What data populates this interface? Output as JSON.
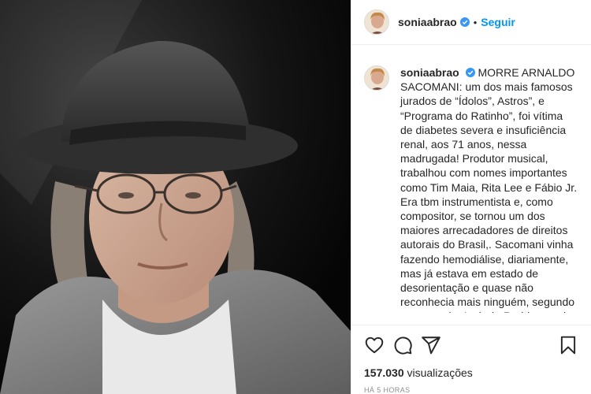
{
  "post": {
    "photo_alt": "photo-portrait-man-hat",
    "header": {
      "username": "soniaabrao",
      "separator": "•",
      "follow_label": "Seguir",
      "verified_icon": "verified-badge-icon"
    },
    "caption": {
      "username": "soniaabrao",
      "text": "MORRE ARNALDO SACOMANI: um dos mais famosos jurados de “Ídolos”, Astros”, e “Programa do Ratinho”, foi vítima de diabetes severa e insuficiência renal, aos 71 anos, nessa madrugada! Produtor musical, trabalhou com nomes importantes como Tim Maia, Rita Lee e Fábio Jr. Era tbm instrumentista e, como compositor, se tornou um dos maiores arrecadadores de direitos autorais do Brasil,. Sacomani vinha fazendo hemodiálise, diariamente, mas já estava em estado de desorientação e quase não reconhecia mais ninguém, segundo seu parceiro Laércio Rodrigues, do SBT. Uma grande perda no mundo artístico! Descanse em paz!",
      "emojis_line1": "🙏😢❤️",
      "emojis_line2": "🖤🎼"
    },
    "actions": {
      "like_icon": "heart-icon",
      "comment_icon": "comment-icon",
      "share_icon": "share-icon",
      "save_icon": "bookmark-icon"
    },
    "views_count": "157.030",
    "views_label": "visualizações",
    "timestamp": "HÁ 5 HORAS",
    "colors": {
      "accent": "#0095f6",
      "text": "#262626",
      "muted": "#8e8e8e",
      "border": "#efefef"
    }
  }
}
